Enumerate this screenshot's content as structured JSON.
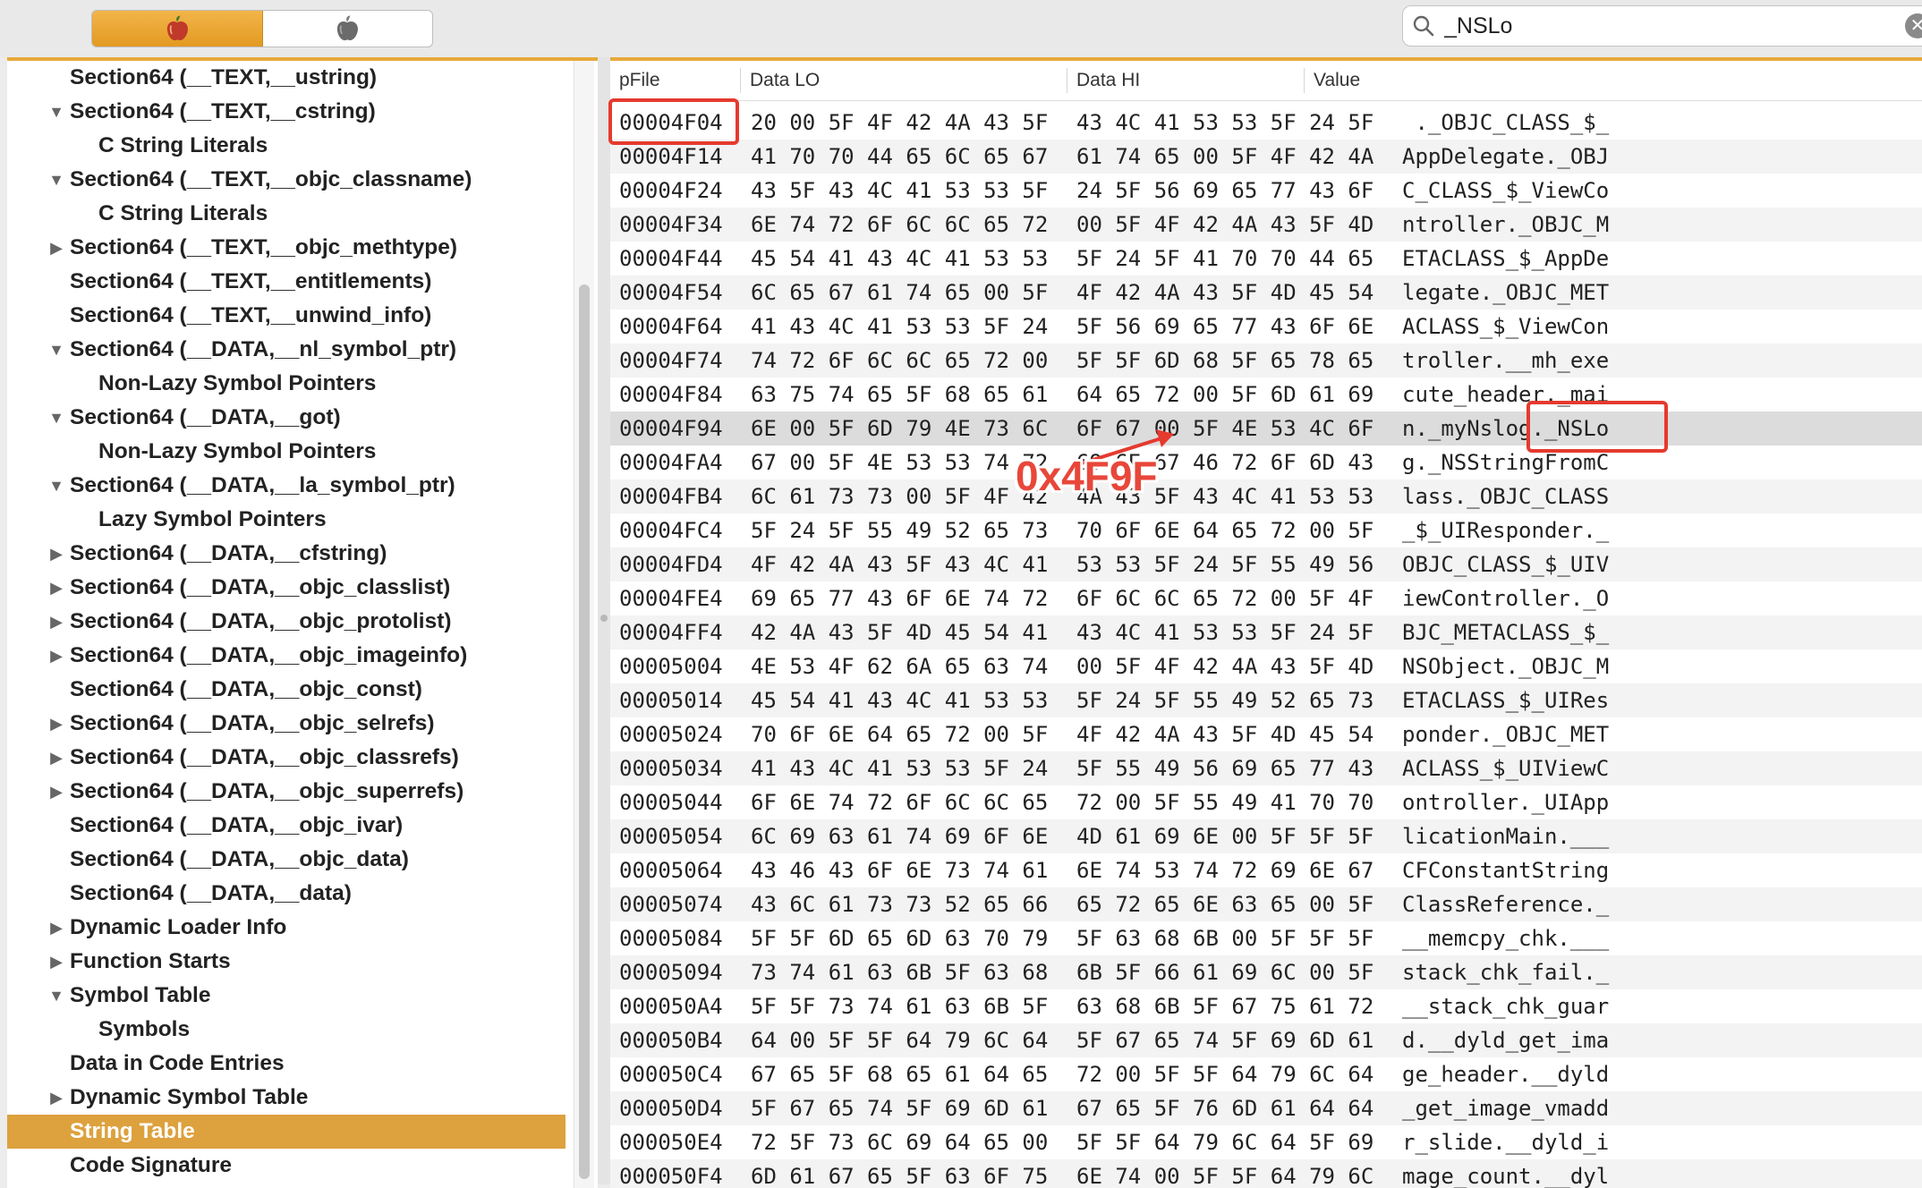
{
  "search": {
    "value": "_NSLo",
    "clear_symbol": "✕"
  },
  "toolbar": {
    "segments": [
      "apple-color-icon",
      "apple-gray-icon"
    ]
  },
  "sidebar": {
    "items": [
      {
        "label": "Section64 (__TEXT,__ustring)",
        "indent": 0,
        "toggle": ""
      },
      {
        "label": "Section64 (__TEXT,__cstring)",
        "indent": 0,
        "toggle": "▼"
      },
      {
        "label": "C String Literals",
        "indent": 1,
        "toggle": ""
      },
      {
        "label": "Section64 (__TEXT,__objc_classname)",
        "indent": 0,
        "toggle": "▼"
      },
      {
        "label": "C String Literals",
        "indent": 1,
        "toggle": ""
      },
      {
        "label": "Section64 (__TEXT,__objc_methtype)",
        "indent": 0,
        "toggle": "▶"
      },
      {
        "label": "Section64 (__TEXT,__entitlements)",
        "indent": 0,
        "toggle": ""
      },
      {
        "label": "Section64 (__TEXT,__unwind_info)",
        "indent": 0,
        "toggle": ""
      },
      {
        "label": "Section64 (__DATA,__nl_symbol_ptr)",
        "indent": 0,
        "toggle": "▼"
      },
      {
        "label": "Non-Lazy Symbol Pointers",
        "indent": 1,
        "toggle": ""
      },
      {
        "label": "Section64 (__DATA,__got)",
        "indent": 0,
        "toggle": "▼"
      },
      {
        "label": "Non-Lazy Symbol Pointers",
        "indent": 1,
        "toggle": ""
      },
      {
        "label": "Section64 (__DATA,__la_symbol_ptr)",
        "indent": 0,
        "toggle": "▼"
      },
      {
        "label": "Lazy Symbol Pointers",
        "indent": 1,
        "toggle": ""
      },
      {
        "label": "Section64 (__DATA,__cfstring)",
        "indent": 0,
        "toggle": "▶"
      },
      {
        "label": "Section64 (__DATA,__objc_classlist)",
        "indent": 0,
        "toggle": "▶"
      },
      {
        "label": "Section64 (__DATA,__objc_protolist)",
        "indent": 0,
        "toggle": "▶"
      },
      {
        "label": "Section64 (__DATA,__objc_imageinfo)",
        "indent": 0,
        "toggle": "▶"
      },
      {
        "label": "Section64 (__DATA,__objc_const)",
        "indent": 0,
        "toggle": ""
      },
      {
        "label": "Section64 (__DATA,__objc_selrefs)",
        "indent": 0,
        "toggle": "▶"
      },
      {
        "label": "Section64 (__DATA,__objc_classrefs)",
        "indent": 0,
        "toggle": "▶"
      },
      {
        "label": "Section64 (__DATA,__objc_superrefs)",
        "indent": 0,
        "toggle": "▶"
      },
      {
        "label": "Section64 (__DATA,__objc_ivar)",
        "indent": 0,
        "toggle": ""
      },
      {
        "label": "Section64 (__DATA,__objc_data)",
        "indent": 0,
        "toggle": ""
      },
      {
        "label": "Section64 (__DATA,__data)",
        "indent": 0,
        "toggle": ""
      },
      {
        "label": "Dynamic Loader Info",
        "indent": 0,
        "toggle": "▶"
      },
      {
        "label": "Function Starts",
        "indent": 0,
        "toggle": "▶"
      },
      {
        "label": "Symbol Table",
        "indent": 0,
        "toggle": "▼"
      },
      {
        "label": "Symbols",
        "indent": 1,
        "toggle": ""
      },
      {
        "label": "Data in Code Entries",
        "indent": 0,
        "toggle": ""
      },
      {
        "label": "Dynamic Symbol Table",
        "indent": 0,
        "toggle": "▶"
      },
      {
        "label": "String Table",
        "indent": 0,
        "toggle": "",
        "selected": true
      },
      {
        "label": "Code Signature",
        "indent": 0,
        "toggle": ""
      }
    ]
  },
  "table": {
    "columns": [
      "pFile",
      "Data LO",
      "Data HI",
      "Value"
    ],
    "rows": [
      [
        "00004F04",
        "20 00 5F 4F 42 4A 43 5F",
        "43 4C 41 53 53 5F 24 5F",
        " ._OBJC_CLASS_$_"
      ],
      [
        "00004F14",
        "41 70 70 44 65 6C 65 67",
        "61 74 65 00 5F 4F 42 4A",
        "AppDelegate._OBJ"
      ],
      [
        "00004F24",
        "43 5F 43 4C 41 53 53 5F",
        "24 5F 56 69 65 77 43 6F",
        "C_CLASS_$_ViewCo"
      ],
      [
        "00004F34",
        "6E 74 72 6F 6C 6C 65 72",
        "00 5F 4F 42 4A 43 5F 4D",
        "ntroller._OBJC_M"
      ],
      [
        "00004F44",
        "45 54 41 43 4C 41 53 53",
        "5F 24 5F 41 70 70 44 65",
        "ETACLASS_$_AppDe"
      ],
      [
        "00004F54",
        "6C 65 67 61 74 65 00 5F",
        "4F 42 4A 43 5F 4D 45 54",
        "legate._OBJC_MET"
      ],
      [
        "00004F64",
        "41 43 4C 41 53 53 5F 24",
        "5F 56 69 65 77 43 6F 6E",
        "ACLASS_$_ViewCon"
      ],
      [
        "00004F74",
        "74 72 6F 6C 6C 65 72 00",
        "5F 5F 6D 68 5F 65 78 65",
        "troller.__mh_exe"
      ],
      [
        "00004F84",
        "63 75 74 65 5F 68 65 61",
        "64 65 72 00 5F 6D 61 69",
        "cute_header._mai"
      ],
      [
        "00004F94",
        "6E 00 5F 6D 79 4E 73 6C",
        "6F 67 00 5F 4E 53 4C 6F",
        "n._myNslog._NSLo"
      ],
      [
        "00004FA4",
        "67 00 5F 4E 53 53 74 72",
        "69 6E 67 46 72 6F 6D 43",
        "g._NSStringFromC"
      ],
      [
        "00004FB4",
        "6C 61 73 73 00 5F 4F 42",
        "4A 43 5F 43 4C 41 53 53",
        "lass._OBJC_CLASS"
      ],
      [
        "00004FC4",
        "5F 24 5F 55 49 52 65 73",
        "70 6F 6E 64 65 72 00 5F",
        "_$_UIResponder._"
      ],
      [
        "00004FD4",
        "4F 42 4A 43 5F 43 4C 41",
        "53 53 5F 24 5F 55 49 56",
        "OBJC_CLASS_$_UIV"
      ],
      [
        "00004FE4",
        "69 65 77 43 6F 6E 74 72",
        "6F 6C 6C 65 72 00 5F 4F",
        "iewController._O"
      ],
      [
        "00004FF4",
        "42 4A 43 5F 4D 45 54 41",
        "43 4C 41 53 53 5F 24 5F",
        "BJC_METACLASS_$_"
      ],
      [
        "00005004",
        "4E 53 4F 62 6A 65 63 74",
        "00 5F 4F 42 4A 43 5F 4D",
        "NSObject._OBJC_M"
      ],
      [
        "00005014",
        "45 54 41 43 4C 41 53 53",
        "5F 24 5F 55 49 52 65 73",
        "ETACLASS_$_UIRes"
      ],
      [
        "00005024",
        "70 6F 6E 64 65 72 00 5F",
        "4F 42 4A 43 5F 4D 45 54",
        "ponder._OBJC_MET"
      ],
      [
        "00005034",
        "41 43 4C 41 53 53 5F 24",
        "5F 55 49 56 69 65 77 43",
        "ACLASS_$_UIViewC"
      ],
      [
        "00005044",
        "6F 6E 74 72 6F 6C 6C 65",
        "72 00 5F 55 49 41 70 70",
        "ontroller._UIApp"
      ],
      [
        "00005054",
        "6C 69 63 61 74 69 6F 6E",
        "4D 61 69 6E 00 5F 5F 5F",
        "licationMain.___"
      ],
      [
        "00005064",
        "43 46 43 6F 6E 73 74 61",
        "6E 74 53 74 72 69 6E 67",
        "CFConstantString"
      ],
      [
        "00005074",
        "43 6C 61 73 73 52 65 66",
        "65 72 65 6E 63 65 00 5F",
        "ClassReference._"
      ],
      [
        "00005084",
        "5F 5F 6D 65 6D 63 70 79",
        "5F 63 68 6B 00 5F 5F 5F",
        "__memcpy_chk.___"
      ],
      [
        "00005094",
        "73 74 61 63 6B 5F 63 68",
        "6B 5F 66 61 69 6C 00 5F",
        "stack_chk_fail._"
      ],
      [
        "000050A4",
        "5F 5F 73 74 61 63 6B 5F",
        "63 68 6B 5F 67 75 61 72",
        "__stack_chk_guar"
      ],
      [
        "000050B4",
        "64 00 5F 5F 64 79 6C 64",
        "5F 67 65 74 5F 69 6D 61",
        "d.__dyld_get_ima"
      ],
      [
        "000050C4",
        "67 65 5F 68 65 61 64 65",
        "72 00 5F 5F 64 79 6C 64",
        "ge_header.__dyld"
      ],
      [
        "000050D4",
        "5F 67 65 74 5F 69 6D 61",
        "67 65 5F 76 6D 61 64 64",
        "_get_image_vmadd"
      ],
      [
        "000050E4",
        "72 5F 73 6C 69 64 65 00",
        "5F 5F 64 79 6C 64 5F 69",
        "r_slide.__dyld_i"
      ],
      [
        "000050F4",
        "6D 61 67 65 5F 63 6F 75",
        "6E 74 00 5F 5F 64 79 6C",
        "mage_count.__dyl"
      ]
    ],
    "highlighted_row": 9
  },
  "annotation": {
    "label": "0x4F9F",
    "color": "#e53a2e"
  }
}
